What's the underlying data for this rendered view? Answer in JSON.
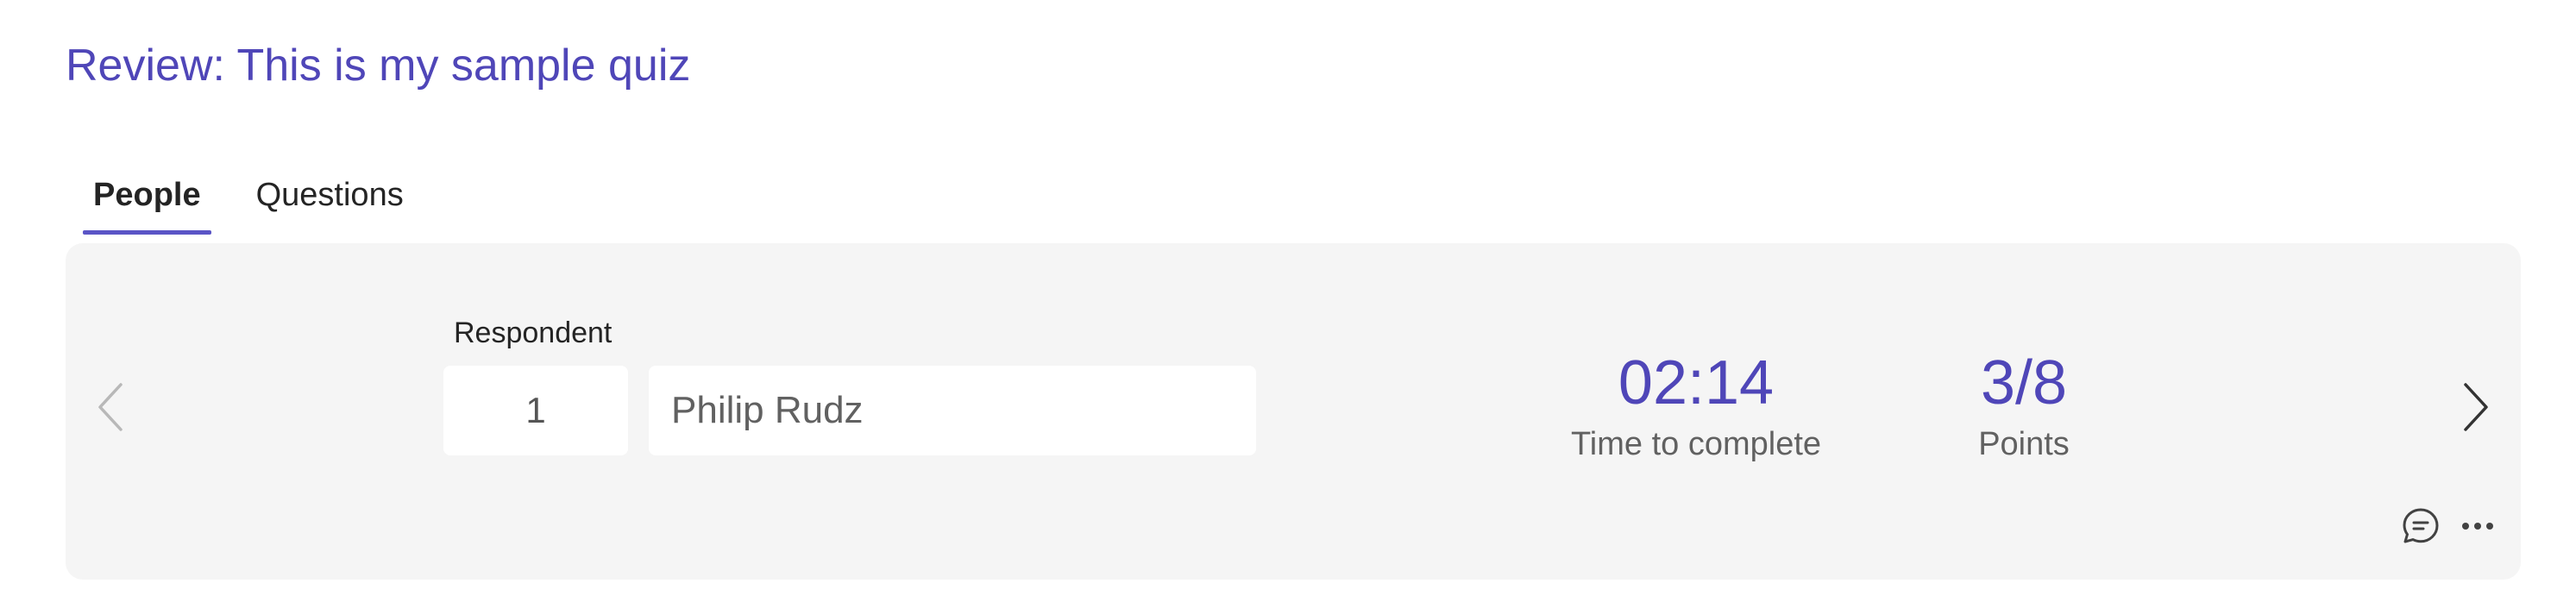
{
  "header": {
    "title": "Review: This is my sample quiz"
  },
  "tabs": [
    {
      "label": "People",
      "active": true
    },
    {
      "label": "Questions",
      "active": false
    }
  ],
  "respondent": {
    "label": "Respondent",
    "number": "1",
    "name": "Philip Rudz"
  },
  "stats": {
    "time": {
      "value": "02:14",
      "label": "Time to complete"
    },
    "points": {
      "value": "3/8",
      "label": "Points"
    }
  },
  "icons": {
    "prev": "chevron-left-icon",
    "next": "chevron-right-icon",
    "comment": "comment-icon",
    "more": "more-icon"
  },
  "colors": {
    "accent": "#4f46b8",
    "card_background": "#f5f5f5"
  }
}
